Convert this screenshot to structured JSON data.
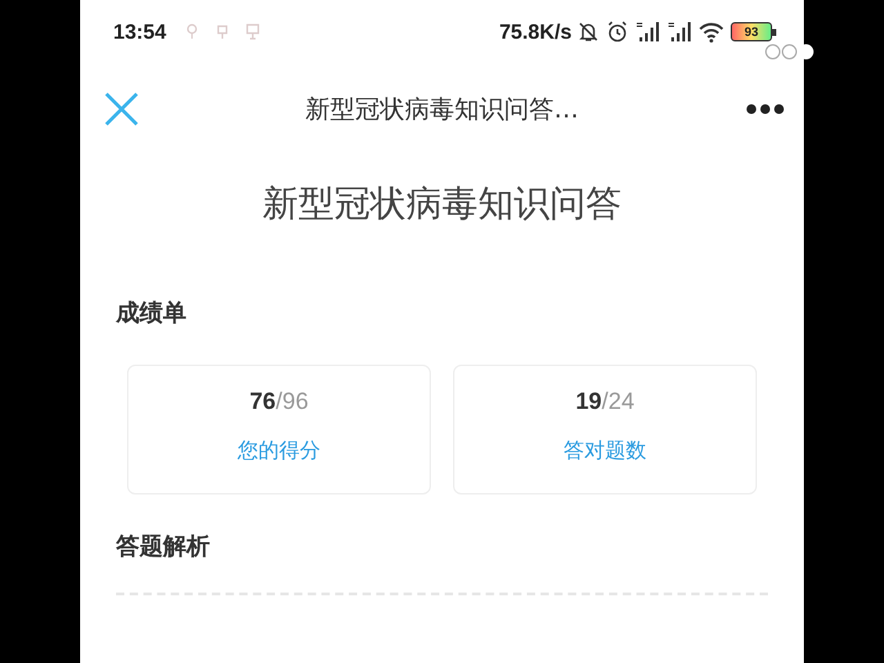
{
  "status_bar": {
    "time": "13:54",
    "speed": "75.8K/s",
    "battery": "93"
  },
  "nav_bar": {
    "title": "新型冠状病毒知识问答…"
  },
  "heading": "新型冠状病毒知识问答",
  "report": {
    "title": "成绩单",
    "cards": [
      {
        "value": "**76**/96",
        "label": "您的得分"
      },
      {
        "value": "**19**/24",
        "label": "答对题数"
      }
    ]
  },
  "analysis": {
    "title": "答题解析"
  },
  "page_indicator": [
    {
      "selected": false
    },
    {
      "selected": false
    },
    {
      "selected": true
    }
  ]
}
